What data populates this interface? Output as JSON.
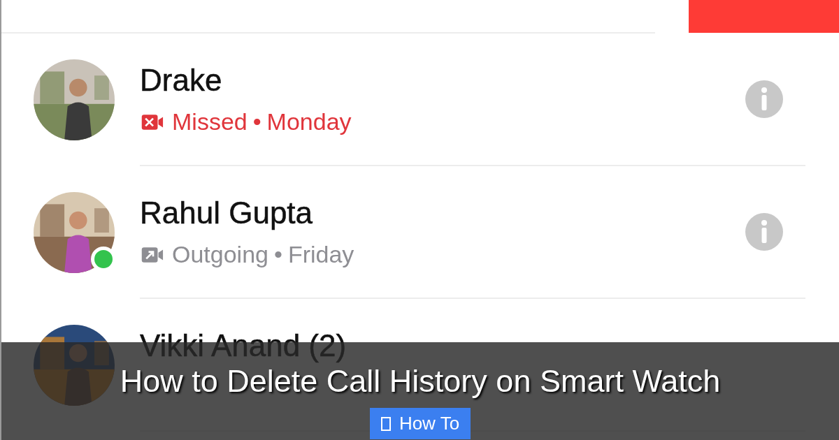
{
  "calls": [
    {
      "name": "Drake",
      "kind": "missed",
      "status": "Missed",
      "separator": "•",
      "when": "Monday",
      "online": false
    },
    {
      "name": "Rahul Gupta",
      "kind": "outgoing",
      "status": "Outgoing",
      "separator": "•",
      "when": "Friday",
      "online": true
    },
    {
      "name": "Vikki Anand (2)",
      "online": false
    }
  ],
  "overlay": {
    "title": "How to Delete Call History on Smart Watch",
    "category": "How To"
  }
}
